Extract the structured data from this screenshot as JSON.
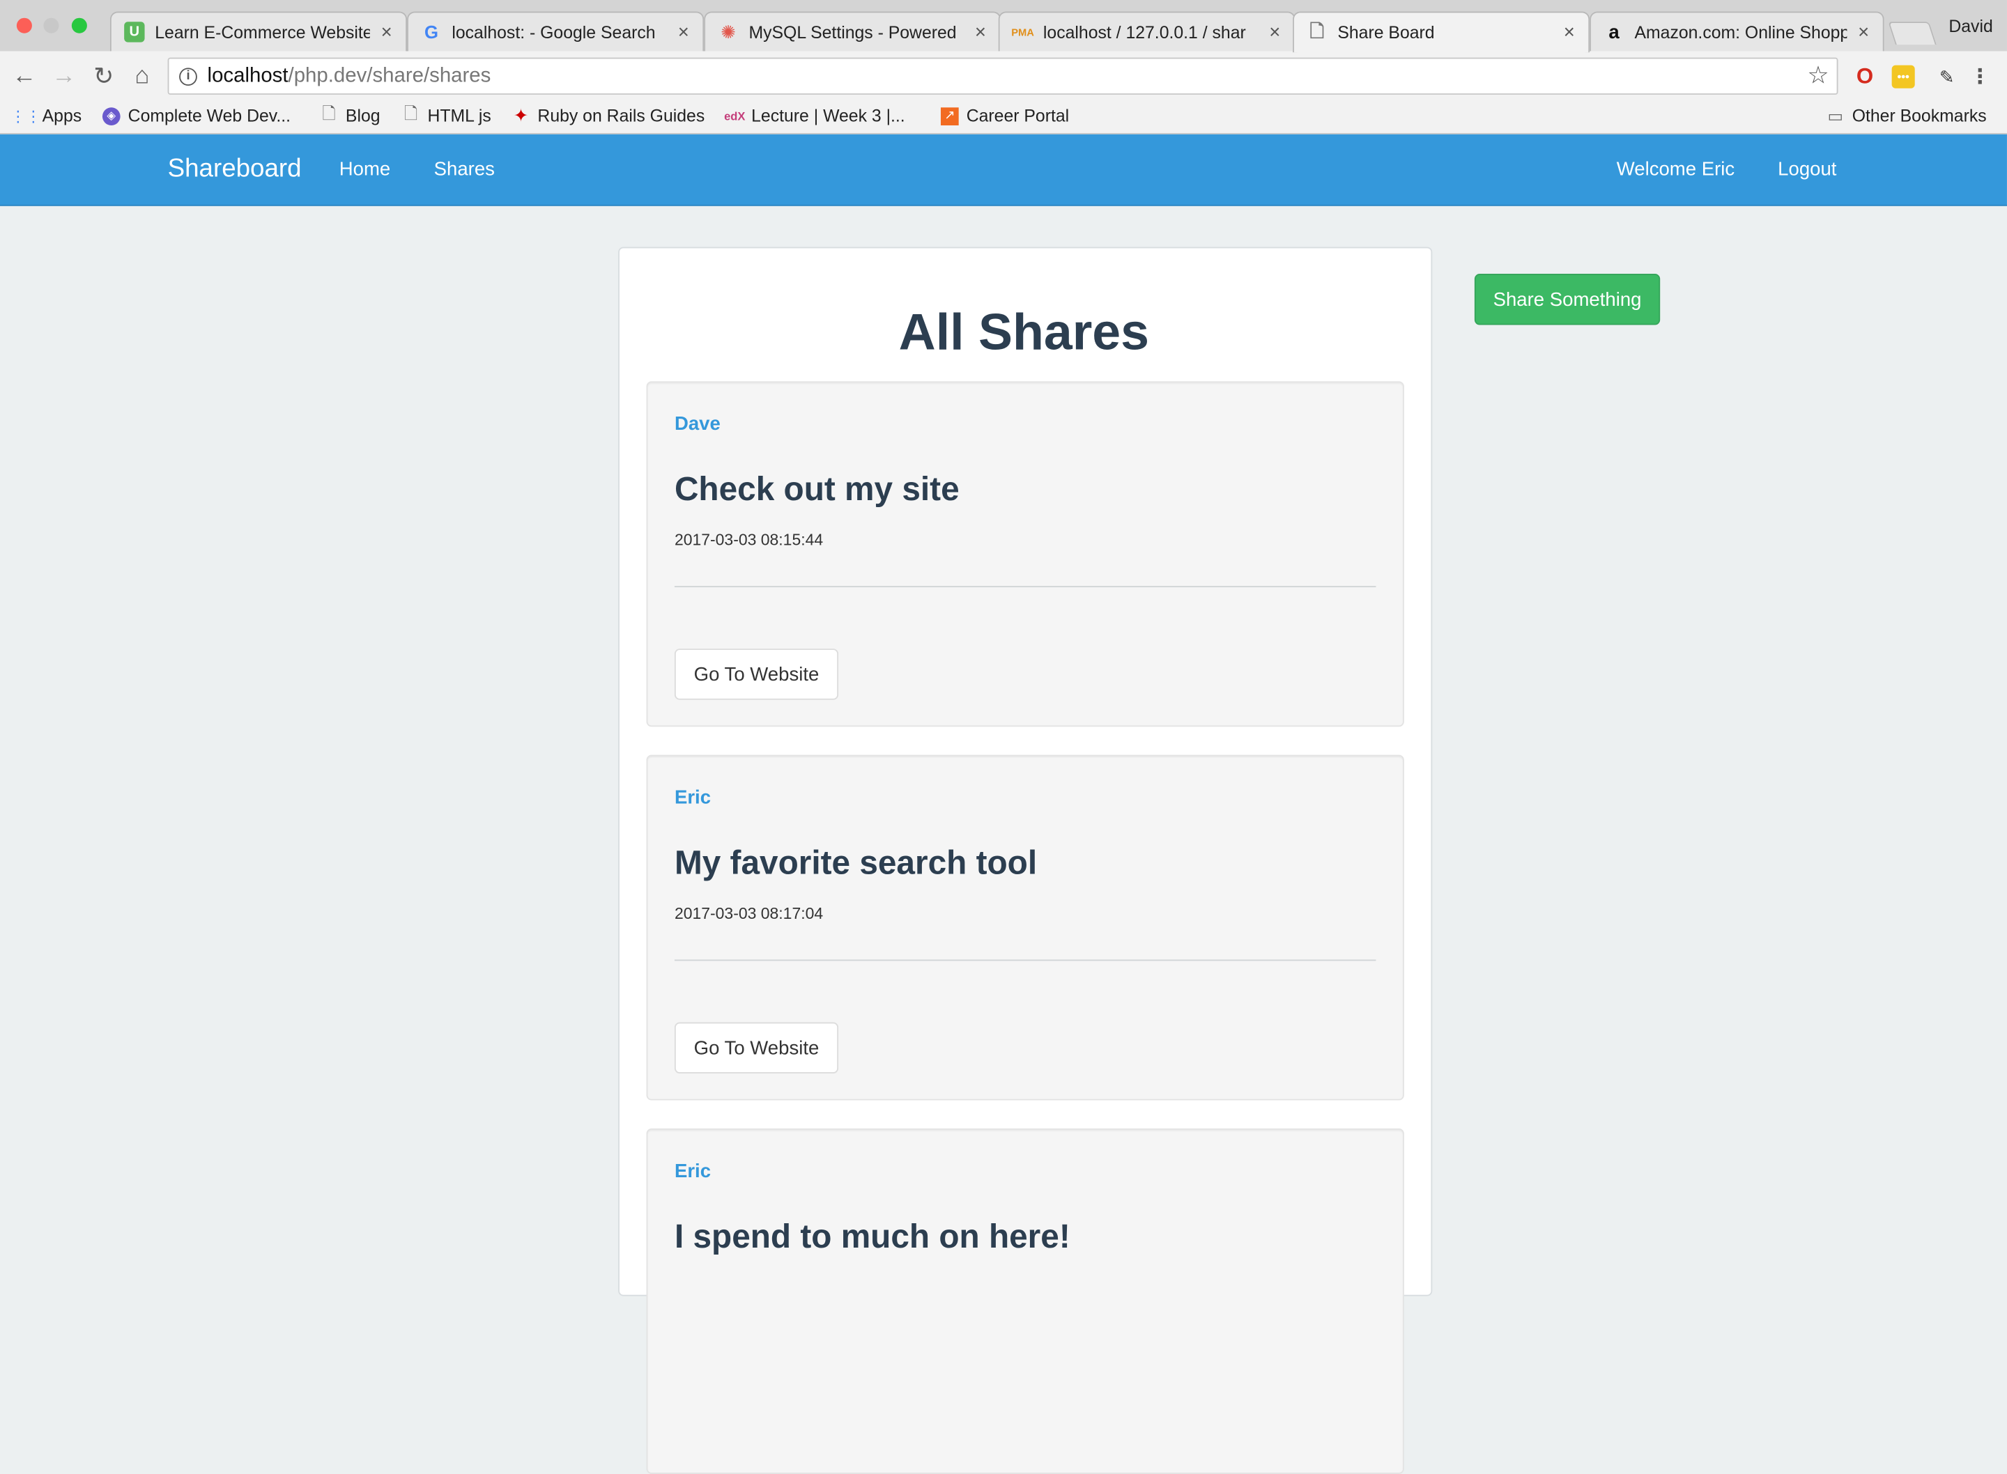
{
  "browser": {
    "tabs": [
      {
        "title": "Learn E-Commerce Website",
        "favicon": "udemy-icon"
      },
      {
        "title": "localhost: - Google Search",
        "favicon": "google-icon"
      },
      {
        "title": "MySQL Settings - Powered",
        "favicon": "gear-logo-icon"
      },
      {
        "title": "localhost / 127.0.0.1 / shar",
        "favicon": "phpmyadmin-icon"
      },
      {
        "title": "Share Board",
        "favicon": "page-icon"
      },
      {
        "title": "Amazon.com: Online Shopp",
        "favicon": "amazon-icon"
      }
    ],
    "active_tab": 4,
    "profile_name": "David",
    "url_host": "localhost",
    "url_path": "/php.dev/share/shares",
    "bookmarks": [
      {
        "label": "Apps",
        "icon": "apps-grid-icon"
      },
      {
        "label": "Complete Web Dev...",
        "icon": "shield-icon"
      },
      {
        "label": "Blog",
        "icon": "page-icon"
      },
      {
        "label": "HTML js",
        "icon": "page-icon"
      },
      {
        "label": "Ruby on Rails Guides",
        "icon": "rails-icon"
      },
      {
        "label": "Lecture | Week 3 |...",
        "icon": "edx-icon"
      },
      {
        "label": "Career Portal",
        "icon": "portal-icon"
      }
    ],
    "other_bookmarks": "Other Bookmarks"
  },
  "site": {
    "brand": "Shareboard",
    "nav": {
      "home": "Home",
      "shares": "Shares"
    },
    "welcome": "Welcome Eric",
    "logout": "Logout",
    "accent_color": "#3498db",
    "success_color": "#3cb964"
  },
  "main": {
    "heading": "All Shares",
    "share_button": "Share Something",
    "shares": [
      {
        "author": "Dave",
        "title": "Check out my site",
        "date": "2017-03-03 08:15:44",
        "button": "Go To Website"
      },
      {
        "author": "Eric",
        "title": "My favorite search tool",
        "date": "2017-03-03 08:17:04",
        "button": "Go To Website"
      },
      {
        "author": "Eric",
        "title": "I spend to much on here!",
        "date": "",
        "button": ""
      }
    ]
  }
}
